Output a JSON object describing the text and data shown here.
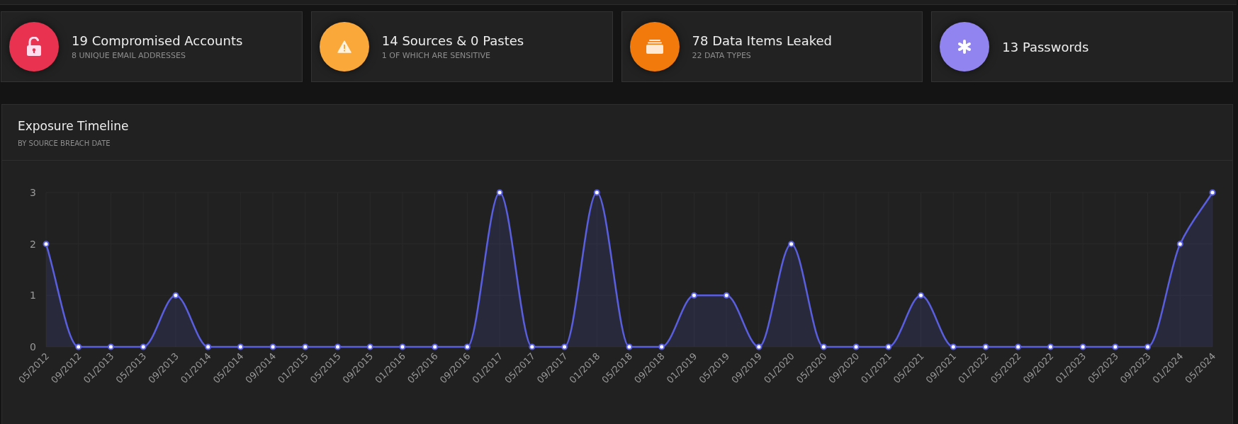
{
  "stats": [
    {
      "kind": "unlock",
      "color": "#e8324f",
      "title": "19 Compromised Accounts",
      "subtitle": "8 UNIQUE EMAIL ADDRESSES"
    },
    {
      "kind": "warning",
      "color": "#fba83a",
      "title": "14 Sources & 0 Pastes",
      "subtitle": "1 OF WHICH ARE SENSITIVE"
    },
    {
      "kind": "stack",
      "color": "#f27a0c",
      "title": "78 Data Items Leaked",
      "subtitle": "22 DATA TYPES"
    },
    {
      "kind": "asterisk",
      "color": "#9184f0",
      "title": "13 Passwords"
    }
  ],
  "timeline": {
    "title": "Exposure Timeline",
    "subtitle": "BY SOURCE BREACH DATE",
    "chart_data": {
      "type": "area",
      "categories": [
        "05/2012",
        "09/2012",
        "01/2013",
        "05/2013",
        "09/2013",
        "01/2014",
        "05/2014",
        "09/2014",
        "01/2015",
        "05/2015",
        "09/2015",
        "01/2016",
        "05/2016",
        "09/2016",
        "01/2017",
        "05/2017",
        "09/2017",
        "01/2018",
        "05/2018",
        "09/2018",
        "01/2019",
        "05/2019",
        "09/2019",
        "01/2020",
        "05/2020",
        "09/2020",
        "01/2021",
        "05/2021",
        "09/2021",
        "01/2022",
        "05/2022",
        "09/2022",
        "01/2023",
        "05/2023",
        "09/2023",
        "01/2024",
        "05/2024"
      ],
      "series": [
        {
          "color": "#5a5fe0",
          "values": [
            2,
            0,
            0,
            0,
            1,
            0,
            0,
            0,
            0,
            0,
            0,
            0,
            0,
            0,
            3,
            0,
            0,
            3,
            0,
            0,
            1,
            1,
            0,
            2,
            0,
            0,
            0,
            1,
            0,
            0,
            0,
            0,
            0,
            0,
            0,
            2,
            3
          ]
        }
      ],
      "ylim": [
        0,
        3
      ],
      "yticks": [
        0,
        1,
        2,
        3
      ]
    }
  }
}
